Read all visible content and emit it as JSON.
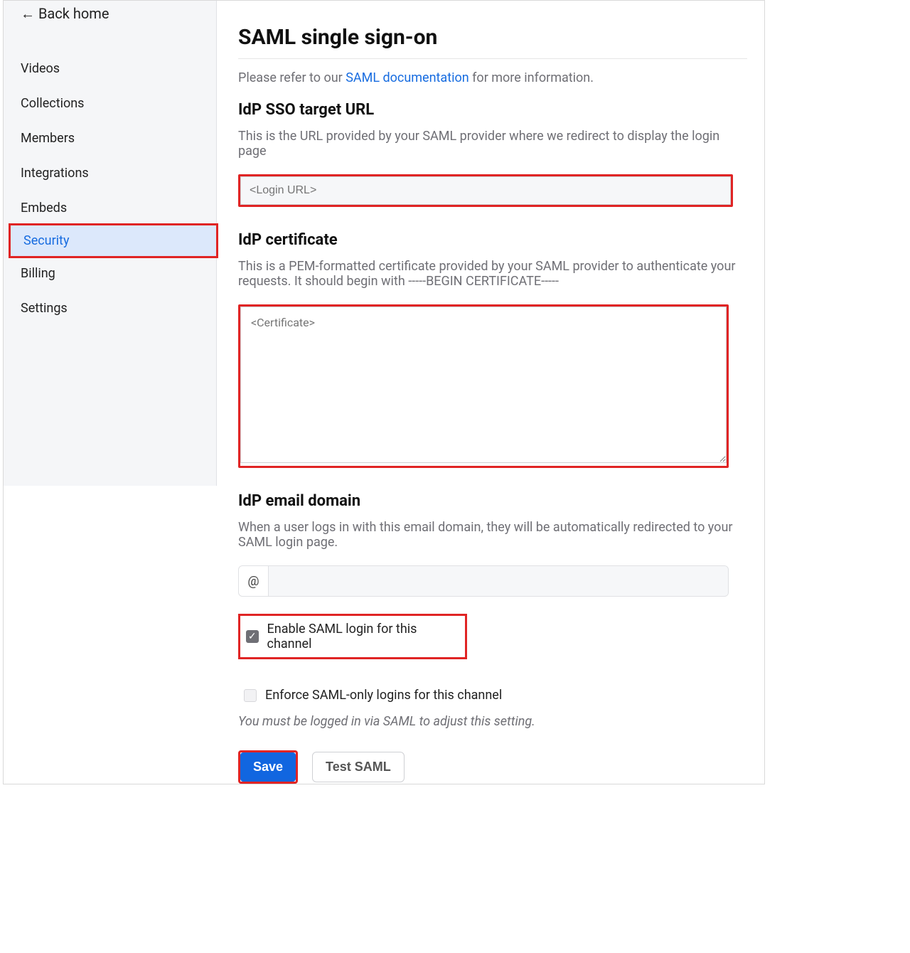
{
  "sidebar": {
    "back_label": "← Back home",
    "items": [
      {
        "label": "Videos"
      },
      {
        "label": "Collections"
      },
      {
        "label": "Members"
      },
      {
        "label": "Integrations"
      },
      {
        "label": "Embeds"
      },
      {
        "label": "Security"
      },
      {
        "label": "Billing"
      },
      {
        "label": "Settings"
      }
    ],
    "active_index": 5
  },
  "page": {
    "title": "SAML single sign-on",
    "help_prefix": "Please refer to our ",
    "help_link_text": "SAML documentation",
    "help_suffix": " for more information."
  },
  "idp_url": {
    "heading": "IdP SSO target URL",
    "desc": "This is the URL provided by your SAML provider where we redirect to display the login page",
    "placeholder": "<Login URL>"
  },
  "idp_cert": {
    "heading": "IdP certificate",
    "desc": "This is a PEM-formatted certificate provided by your SAML provider to authenticate your requests. It should begin with -----BEGIN CERTIFICATE-----",
    "placeholder": "<Certificate>"
  },
  "idp_domain": {
    "heading": "IdP email domain",
    "desc": "When a user logs in with this email domain, they will be automatically redirected to your SAML login page.",
    "prefix": "@",
    "value": ""
  },
  "enable_saml": {
    "label": "Enable SAML login for this channel",
    "checked": true
  },
  "enforce_saml": {
    "label": "Enforce SAML-only logins for this channel",
    "checked": false,
    "hint": "You must be logged in via SAML to adjust this setting."
  },
  "buttons": {
    "save": "Save",
    "test": "Test SAML"
  }
}
